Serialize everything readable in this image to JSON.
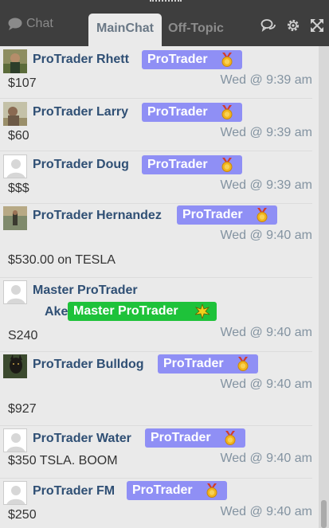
{
  "header": {
    "chat_label": "Chat",
    "tabs": [
      {
        "label": "MainChat",
        "active": true
      },
      {
        "label": "Off-Topic",
        "active": false
      }
    ],
    "icons": [
      "chat-bubbles-icon",
      "gear-icon",
      "expand-icon"
    ]
  },
  "colors": {
    "header_bg": "#3e3e3e",
    "chat_bg": "#eaeaea",
    "name": "#2f4f74",
    "timestamp": "#8393a1",
    "protrader_badge": "#8f8ff5",
    "master_badge": "#1ec23a"
  },
  "messages": [
    {
      "name": "ProTrader Rhett",
      "badge": "ProTrader",
      "time": "Wed @ 9:39 am",
      "text": "$107",
      "avatar": "photo-icon"
    },
    {
      "name": "ProTrader Larry",
      "badge": "ProTrader",
      "time": "Wed @ 9:39 am",
      "text": "$60",
      "avatar": "photo-icon"
    },
    {
      "name": "ProTrader Doug",
      "badge": "ProTrader",
      "time": "Wed @ 9:39 am",
      "text": "$$$",
      "avatar": "default-user-icon"
    },
    {
      "name": "ProTrader Hernandez",
      "badge": "ProTrader",
      "time": "Wed @ 9:40 am",
      "text": "$530.00 on TESLA",
      "avatar": "photo-icon"
    },
    {
      "name_line1": "Master ProTrader",
      "name_line2": "Aker",
      "badge": "Master ProTrader",
      "time": "Wed @ 9:40 am",
      "text": "S240",
      "avatar": "default-user-icon"
    },
    {
      "name": "ProTrader Bulldog",
      "badge": "ProTrader",
      "time": "Wed @ 9:40 am",
      "text": "$927",
      "avatar": "dog-photo-icon"
    },
    {
      "name": "ProTrader Water",
      "badge": "ProTrader",
      "time": "Wed @ 9:40 am",
      "text": "$350 TSLA. BOOM",
      "avatar": "default-user-icon"
    },
    {
      "name": "ProTrader FM",
      "badge": "ProTrader",
      "time": "Wed @ 9:40 am",
      "text": "$250",
      "avatar": "default-user-icon"
    }
  ]
}
